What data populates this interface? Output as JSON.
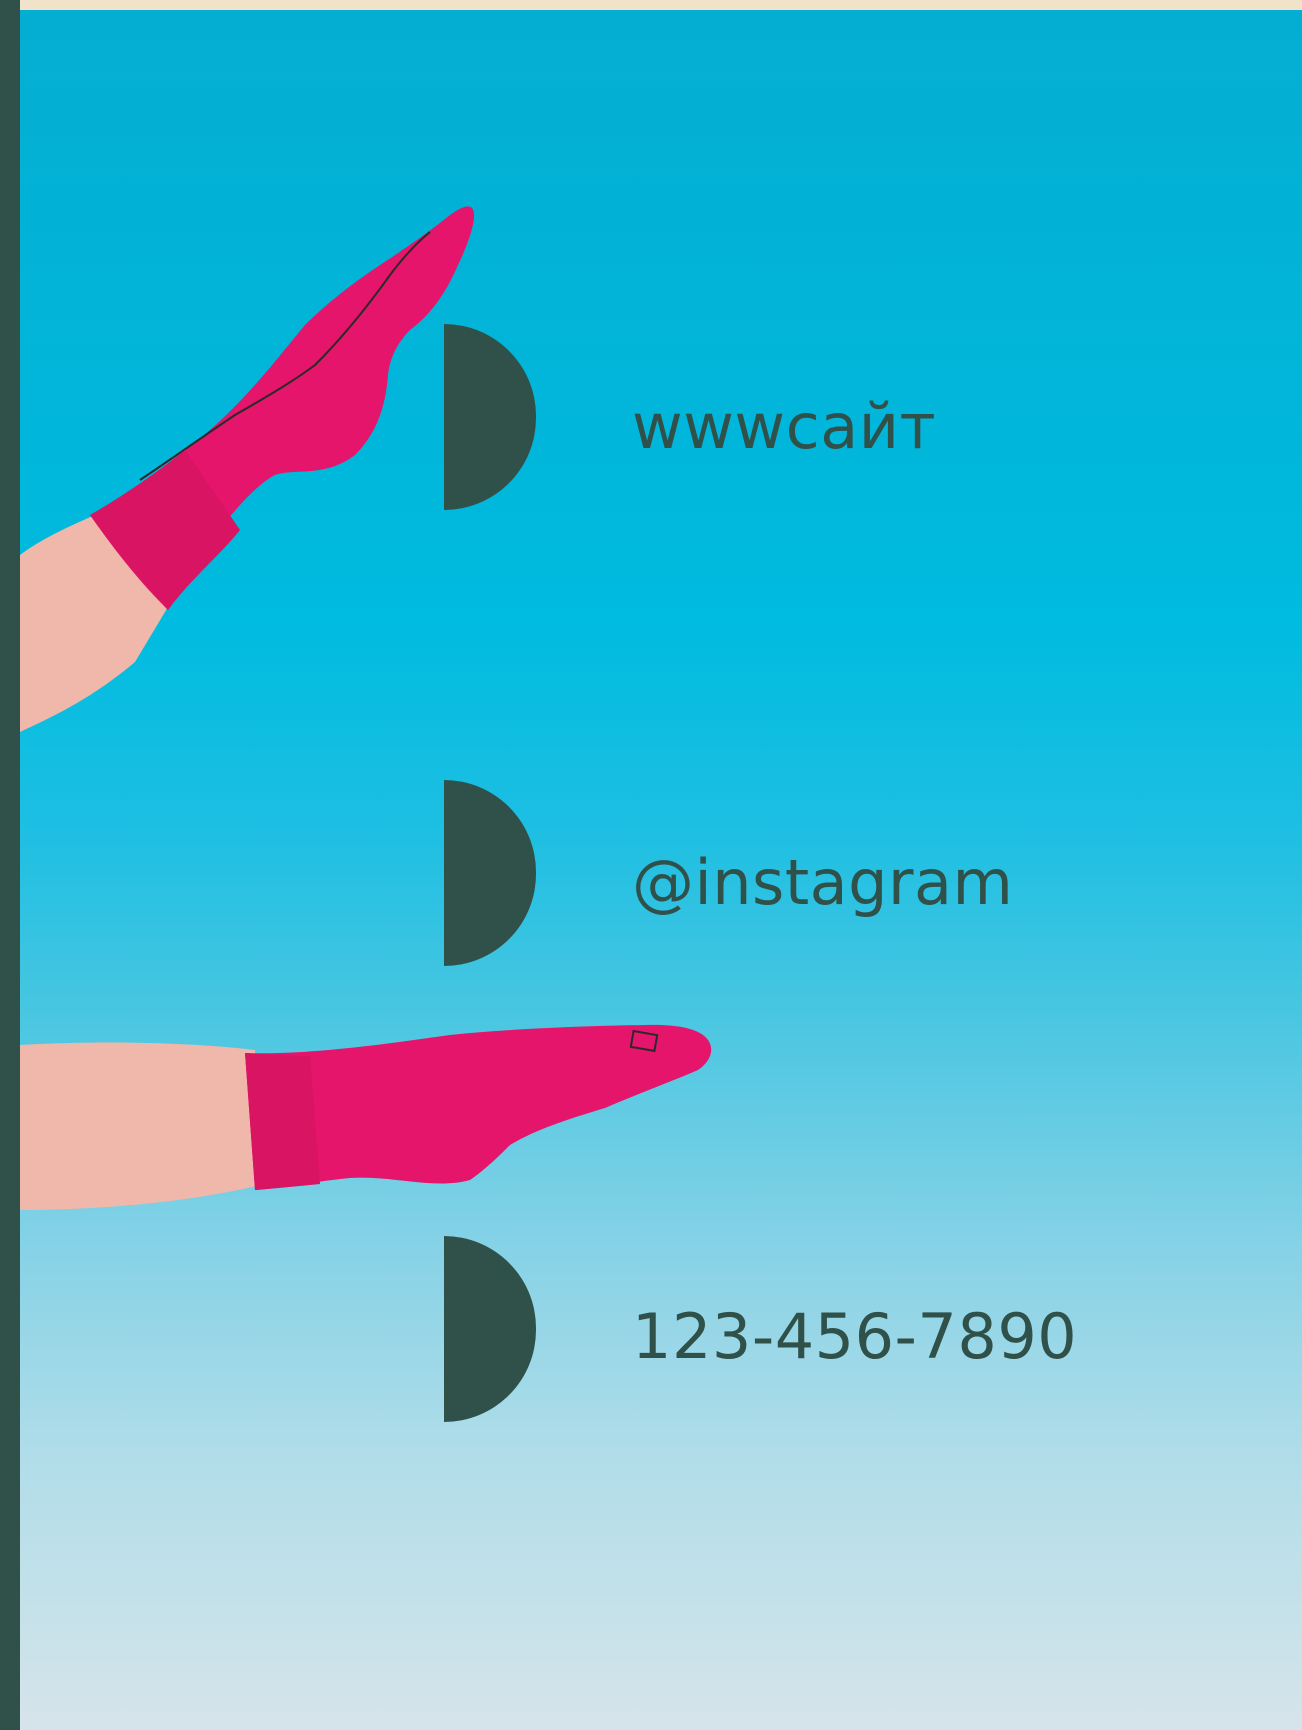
{
  "contacts": {
    "website": "wwwсайт",
    "instagram": "@instagram",
    "phone": "123-456-7890"
  },
  "colors": {
    "accent": "#30504a",
    "top_stripe": "#f1e3c9",
    "sky_top": "#00b8dc",
    "sky_bottom": "#d6e4ea",
    "sock": "#e5156b"
  }
}
